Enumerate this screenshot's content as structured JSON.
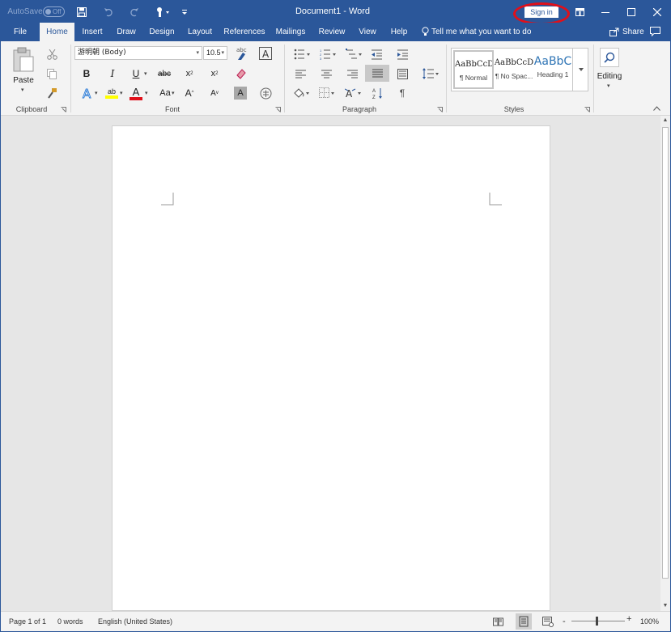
{
  "titlebar": {
    "autosave_label": "AutoSave",
    "autosave_state": "Off",
    "doc_title": "Document1  -  Word",
    "signin_label": "Sign in",
    "highlight_color": "#e0101a",
    "bg_color": "#2b579a"
  },
  "tabs": [
    {
      "label": "File"
    },
    {
      "label": "Home",
      "active": true
    },
    {
      "label": "Insert"
    },
    {
      "label": "Draw"
    },
    {
      "label": "Design"
    },
    {
      "label": "Layout"
    },
    {
      "label": "References"
    },
    {
      "label": "Mailings"
    },
    {
      "label": "Review"
    },
    {
      "label": "View"
    },
    {
      "label": "Help"
    }
  ],
  "tellme": {
    "label": "Tell me what you want to do"
  },
  "share": {
    "label": "Share"
  },
  "ribbon": {
    "clipboard": {
      "label": "Clipboard",
      "paste_label": "Paste"
    },
    "font": {
      "label": "Font",
      "font_name": "游明朝 (Body)",
      "font_size": "10.5",
      "bold": "B",
      "italic": "I",
      "underline": "U",
      "strike": "abc",
      "subscript": "x",
      "superscript": "x",
      "color_a": "A",
      "change_case": "Aa",
      "grow": "A",
      "shrink": "A",
      "char_shade": "A",
      "clear_abc": "abc",
      "highlight_abc": "ab"
    },
    "paragraph": {
      "label": "Paragraph"
    },
    "styles": {
      "label": "Styles",
      "items": [
        {
          "sample": "AaBbCcD",
          "name": "¶ Normal"
        },
        {
          "sample": "AaBbCcD",
          "name": "¶ No Spac..."
        },
        {
          "sample": "AaBbC",
          "name": "Heading 1"
        }
      ]
    },
    "editing": {
      "label": "Editing"
    }
  },
  "statusbar": {
    "page": "Page 1 of 1",
    "words": "0 words",
    "language": "English (United States)",
    "zoom": "100%",
    "zoom_minus": "-",
    "zoom_plus": "+"
  }
}
